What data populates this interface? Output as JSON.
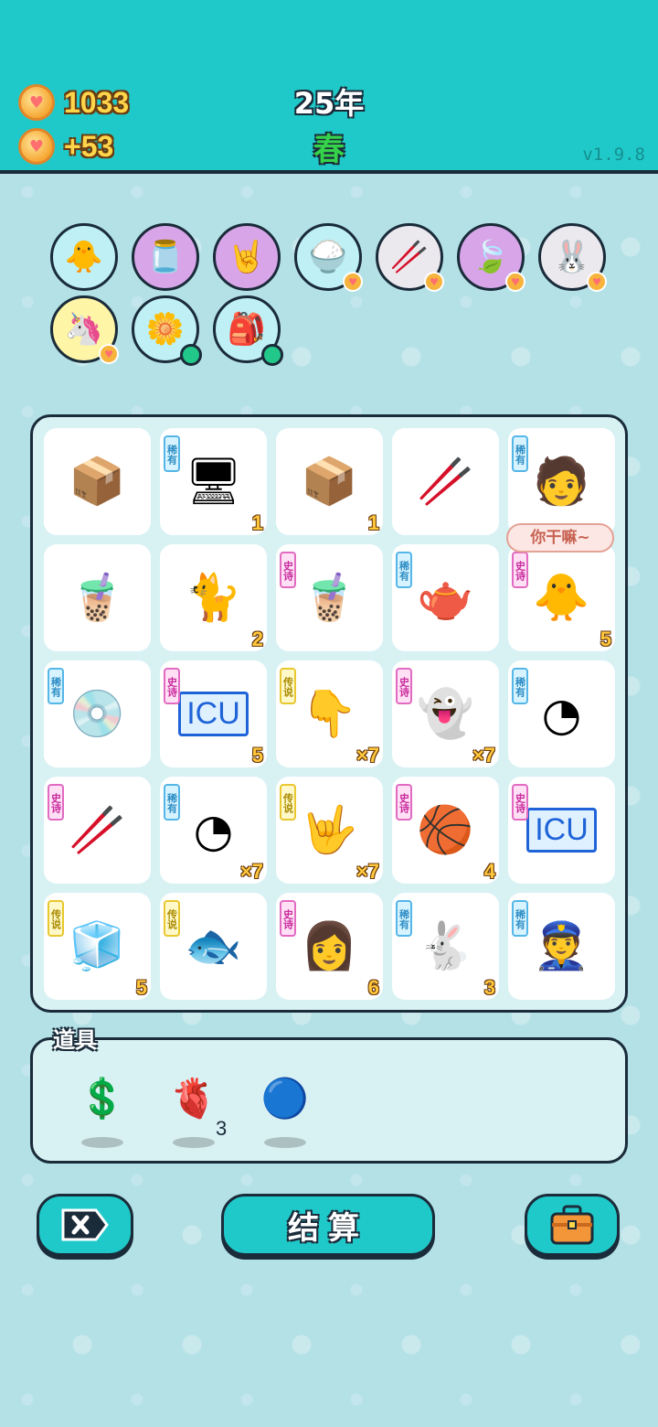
{
  "header": {
    "coins": "1033",
    "income": "+53",
    "year": "25年",
    "season": "春",
    "version": "v1.9.8"
  },
  "top_icons": [
    {
      "name": "chick-egg",
      "icon": "🐥",
      "bg": "blue",
      "badge": "none"
    },
    {
      "name": "jar",
      "icon": "🫙",
      "bg": "purple",
      "badge": "none"
    },
    {
      "name": "rock-hand",
      "icon": "🤘",
      "bg": "purple",
      "badge": "none"
    },
    {
      "name": "rice-bowl",
      "icon": "🍚",
      "bg": "blue",
      "badge": "heart"
    },
    {
      "name": "chopsticks",
      "icon": "🥢",
      "bg": "grey",
      "badge": "heart"
    },
    {
      "name": "leaf",
      "icon": "🍃",
      "bg": "purple",
      "badge": "heart"
    },
    {
      "name": "rabbit",
      "icon": "🐰",
      "bg": "grey",
      "badge": "heart"
    },
    {
      "name": "unicorn",
      "icon": "🦄",
      "bg": "yellow",
      "badge": "heart"
    },
    {
      "name": "flower-pot",
      "icon": "🌼",
      "bg": "blue",
      "badge": "dot"
    },
    {
      "name": "sack",
      "icon": "🎒",
      "bg": "blue",
      "badge": "dot"
    }
  ],
  "rarity_labels": {
    "rare": "稀有",
    "epic": "史诗",
    "legend": "传说"
  },
  "grid": [
    [
      {
        "name": "parcel-box",
        "icon": "📦",
        "tag": "",
        "count": ""
      },
      {
        "name": "pc-tower",
        "icon": "🖥",
        "tag": "稀有",
        "count": "1"
      },
      {
        "name": "parcel-box",
        "icon": "📦",
        "tag": "",
        "count": "1"
      },
      {
        "name": "straw",
        "icon": "🥢",
        "tag": "",
        "count": ""
      },
      {
        "name": "glasses-boy",
        "icon": "🧑",
        "tag": "稀有",
        "count": ""
      }
    ],
    [
      {
        "name": "milk-tea-small",
        "icon": "🧋",
        "tag": "",
        "count": ""
      },
      {
        "name": "orange-cat",
        "icon": "🐈",
        "tag": "",
        "count": "2"
      },
      {
        "name": "milk-tea-large",
        "icon": "🧋",
        "tag": "史诗",
        "count": ""
      },
      {
        "name": "teapot",
        "icon": "🫖",
        "tag": "稀有",
        "count": ""
      },
      {
        "name": "chick-with-hair",
        "icon": "🐥",
        "tag": "史诗",
        "count": "5"
      }
    ],
    [
      {
        "name": "cd-disc",
        "icon": "💿",
        "tag": "稀有",
        "count": ""
      },
      {
        "name": "icu-sign",
        "icon": "ICU",
        "tag": "史诗",
        "count": "5"
      },
      {
        "name": "pointing-hand",
        "icon": "👇",
        "tag": "传说",
        "count": "×7"
      },
      {
        "name": "ghost",
        "icon": "👻",
        "tag": "史诗",
        "count": "×7"
      },
      {
        "name": "speedometer",
        "icon": "◔",
        "tag": "稀有",
        "count": ""
      }
    ],
    [
      {
        "name": "straw",
        "icon": "🥢",
        "tag": "史诗",
        "count": ""
      },
      {
        "name": "speedometer",
        "icon": "◔",
        "tag": "稀有",
        "count": "×7"
      },
      {
        "name": "rock-hand",
        "icon": "🤟",
        "tag": "传说",
        "count": "×7"
      },
      {
        "name": "basketball-chick",
        "icon": "🏀",
        "tag": "史诗",
        "count": "4"
      },
      {
        "name": "icu-sign",
        "icon": "ICU",
        "tag": "史诗",
        "count": ""
      }
    ],
    [
      {
        "name": "fridge",
        "icon": "🧊",
        "tag": "传说",
        "count": "5"
      },
      {
        "name": "koi-fish",
        "icon": "🐟",
        "tag": "传说",
        "count": ""
      },
      {
        "name": "girl",
        "icon": "👩",
        "tag": "史诗",
        "count": "6"
      },
      {
        "name": "rabbit-red",
        "icon": "🐇",
        "tag": "稀有",
        "count": "3"
      },
      {
        "name": "police-man",
        "icon": "👮",
        "tag": "稀有",
        "count": ""
      }
    ]
  ],
  "speech_bubble": "你干嘛~",
  "tools": {
    "title": "道具",
    "items": [
      {
        "name": "coin-dollar",
        "icon": "💲",
        "count": ""
      },
      {
        "name": "liver",
        "icon": "🫀",
        "count": "3"
      },
      {
        "name": "blue-ball",
        "icon": "🔵",
        "count": ""
      }
    ]
  },
  "buttons": {
    "settle": "结算"
  },
  "colors": {
    "header": "#20c9c9",
    "background": "#b4e1e6",
    "outline": "#1a2b3a",
    "coin_text": "#ffd54a",
    "season": "#35d24a"
  }
}
